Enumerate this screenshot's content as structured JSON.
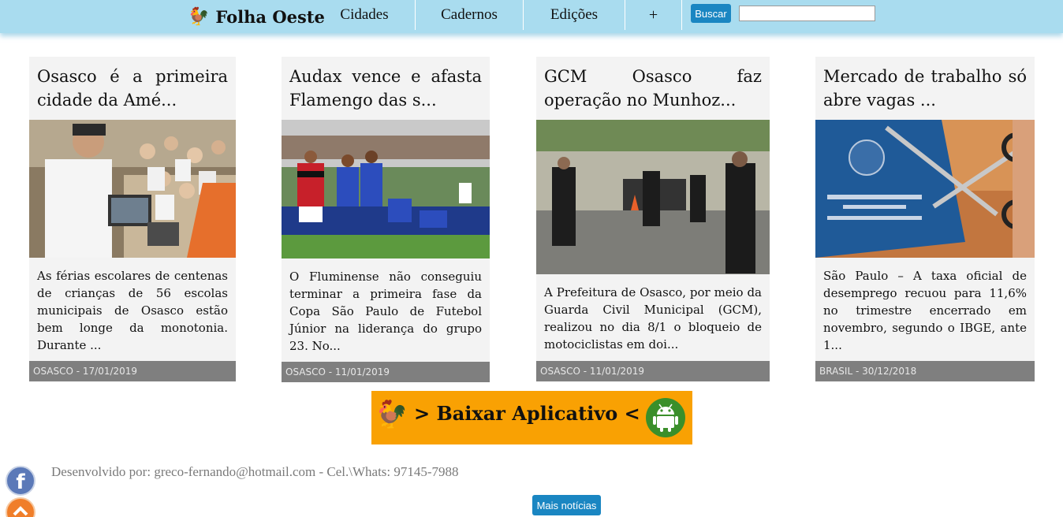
{
  "header": {
    "logo_text": "Folha Oeste",
    "nav": [
      "Cidades",
      "Cadernos",
      "Edições",
      "+"
    ],
    "search_button": "Buscar",
    "search_value": ""
  },
  "cards": [
    {
      "title": "Osasco é a primeira cidade da Amé...",
      "text": "As férias escolares de centenas de crianças de 56 escolas municipais de Osasco estão bem longe da monotonia. Durante ...",
      "footer": "OSASCO - 17/01/2019"
    },
    {
      "title": "Audax vence e afasta Flamengo das s...",
      "text": "O Fluminense não conseguiu terminar a primeira fase da Copa São Paulo de Futebol Júnior na liderança do grupo 23. No...",
      "footer": "OSASCO - 11/01/2019"
    },
    {
      "title": "GCM Osasco faz operação no Munhoz...",
      "text": "A Prefeitura de Osasco, por meio da Guarda Civil Municipal (GCM), realizou no dia 8/1 o bloqueio de motociclistas em doi...",
      "footer": "OSASCO - 11/01/2019"
    },
    {
      "title": "Mercado de trabalho só abre vagas ...",
      "text": "São Paulo – A taxa oficial de desemprego recuou para 11,6% no trimestre encerrado em novembro, segundo o IBGE, ante 1...",
      "footer": "BRASIL - 30/12/2018"
    }
  ],
  "banner": {
    "text": "> Baixar Aplicativo <",
    "icon": "android-icon"
  },
  "footer": {
    "developer": "Desenvolvido por: greco-fernando@hotmail.com - Cel.\\Whats: 97145-7988",
    "more_button": "Mais notícias"
  }
}
